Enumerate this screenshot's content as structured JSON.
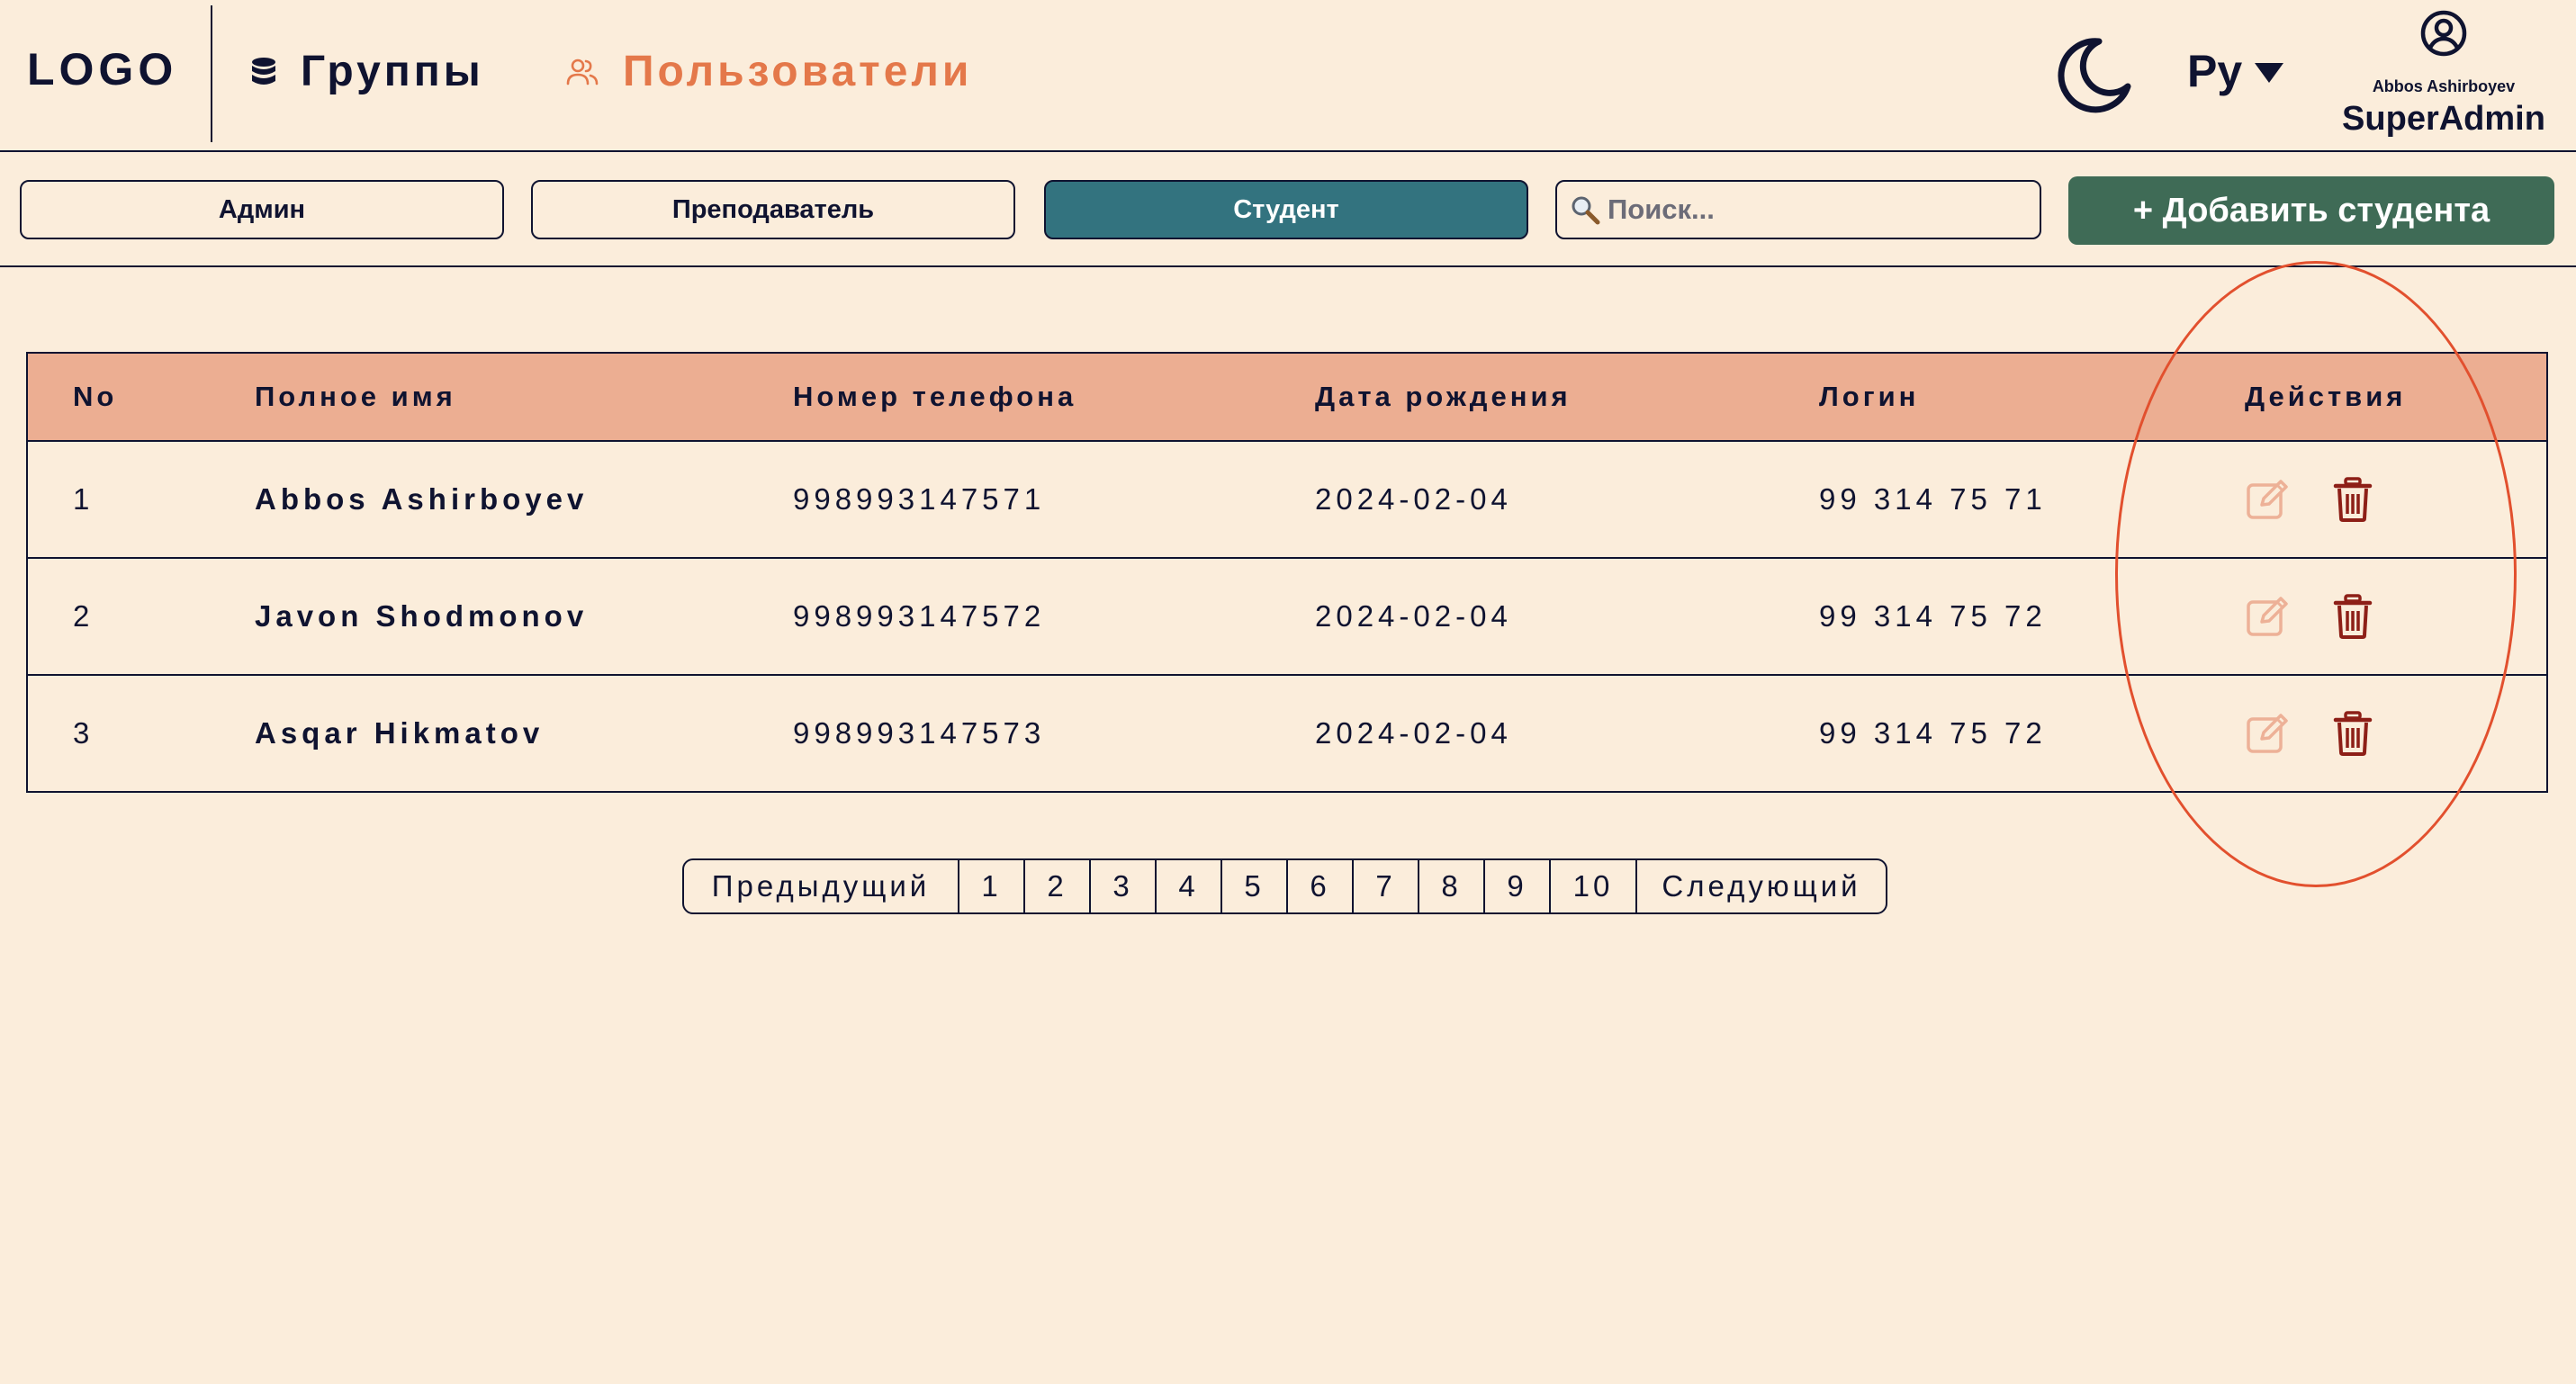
{
  "header": {
    "logo": "LOGO",
    "nav": [
      {
        "label": "Группы",
        "active": false,
        "icon": "database-icon"
      },
      {
        "label": "Пользователи",
        "active": true,
        "icon": "users-icon"
      }
    ],
    "theme_icon": "moon-icon",
    "language": "Ру",
    "user": {
      "name": "Abbos Ashirboyev",
      "role": "SuperAdmin",
      "icon": "user-circle-icon"
    }
  },
  "toolbar": {
    "tabs": [
      {
        "label": "Админ",
        "active": false
      },
      {
        "label": "Преподаватель",
        "active": false
      },
      {
        "label": "Студент",
        "active": true
      }
    ],
    "search": {
      "placeholder": "Поиск...",
      "value": ""
    },
    "add_button": "+ Добавить студента"
  },
  "table": {
    "headers": {
      "no": "No",
      "name": "Полное имя",
      "phone": "Номер телефона",
      "dob": "Дата рождения",
      "login": "Логин",
      "actions": "Действия"
    },
    "rows": [
      {
        "no": "1",
        "name": "Abbos Ashirboyev",
        "phone": "998993147571",
        "dob": "2024-02-04",
        "login": "99 314 75 71"
      },
      {
        "no": "2",
        "name": "Javon Shodmonov",
        "phone": "998993147572",
        "dob": "2024-02-04",
        "login": "99 314 75 72"
      },
      {
        "no": "3",
        "name": "Asqar Hikmatov",
        "phone": "998993147573",
        "dob": "2024-02-04",
        "login": "99 314 75 72"
      }
    ],
    "action_icons": [
      "edit-icon",
      "trash-icon"
    ]
  },
  "pagination": {
    "prev": "Предыдущий",
    "pages": [
      "1",
      "2",
      "3",
      "4",
      "5",
      "6",
      "7",
      "8",
      "9",
      "10"
    ],
    "next": "Следующий"
  },
  "colors": {
    "background": "#fbeddb",
    "text": "#0f1330",
    "accent_orange": "#e4784a",
    "table_header": "#ecae92",
    "tab_active": "#33737f",
    "add_button": "#3f6b56",
    "edit_icon": "#edb197",
    "trash_icon": "#8d1f17",
    "annotation": "#e2502e"
  }
}
